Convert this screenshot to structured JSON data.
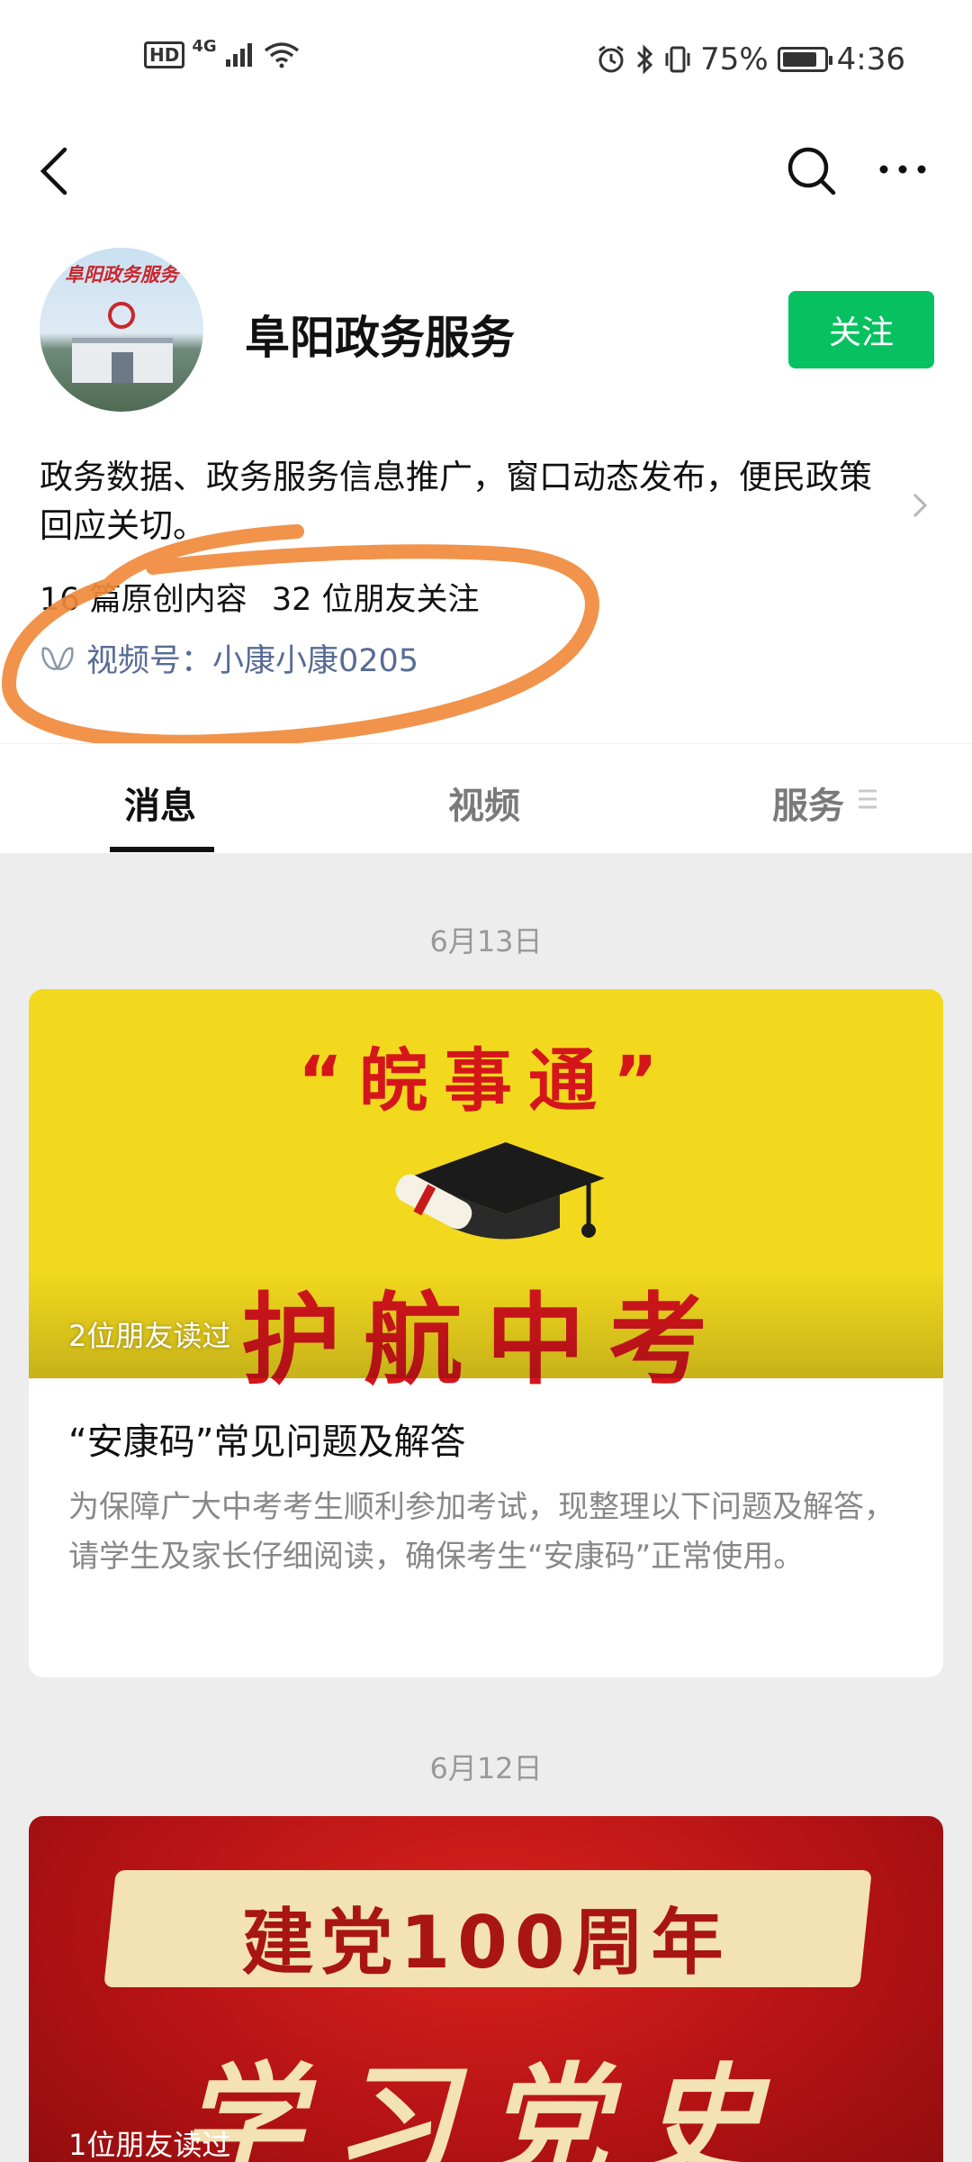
{
  "status": {
    "left_badge": "HD",
    "network": "4G",
    "battery_percent": "75%",
    "time": "4:36"
  },
  "icons": {
    "back": "chevron-left-icon",
    "search": "search-icon",
    "more": "more-horizontal-icon",
    "channel": "video-channel-icon"
  },
  "profile": {
    "name": "阜阳政务服务",
    "avatar_arc_text": "阜阳政务服务",
    "follow_label": "关注",
    "description": "政务数据、政务服务信息推广，窗口动态发布，便民政策回应关切。",
    "original_count": "16 篇原创内容",
    "friends_follow": "32 位朋友关注",
    "channel_label": "视频号：小康小康0205"
  },
  "tabs": [
    {
      "label": "消息",
      "active": true
    },
    {
      "label": "视频",
      "active": false
    },
    {
      "label": "服务",
      "active": false
    }
  ],
  "feed": [
    {
      "date": "6月13日",
      "cover_quote": "“皖事通”",
      "cover_big": "护航中考",
      "read_by": "2位朋友读过",
      "title": "“安康码”常见问题及解答",
      "digest": "为保障广大中考考生顺利参加考试，现整理以下问题及解答，请学生及家长仔细阅读，确保考生“安康码”正常使用。"
    },
    {
      "date": "6月12日",
      "cover_banner": "建党100周年",
      "cover_big": "学习党史",
      "read_by": "1位朋友读过"
    }
  ],
  "colors": {
    "follow_green": "#07c160",
    "link_blue": "#576b95",
    "annotation_orange": "#f08a3c",
    "cover_yellow": "#f2d91e",
    "cover_red": "#d4161b"
  }
}
